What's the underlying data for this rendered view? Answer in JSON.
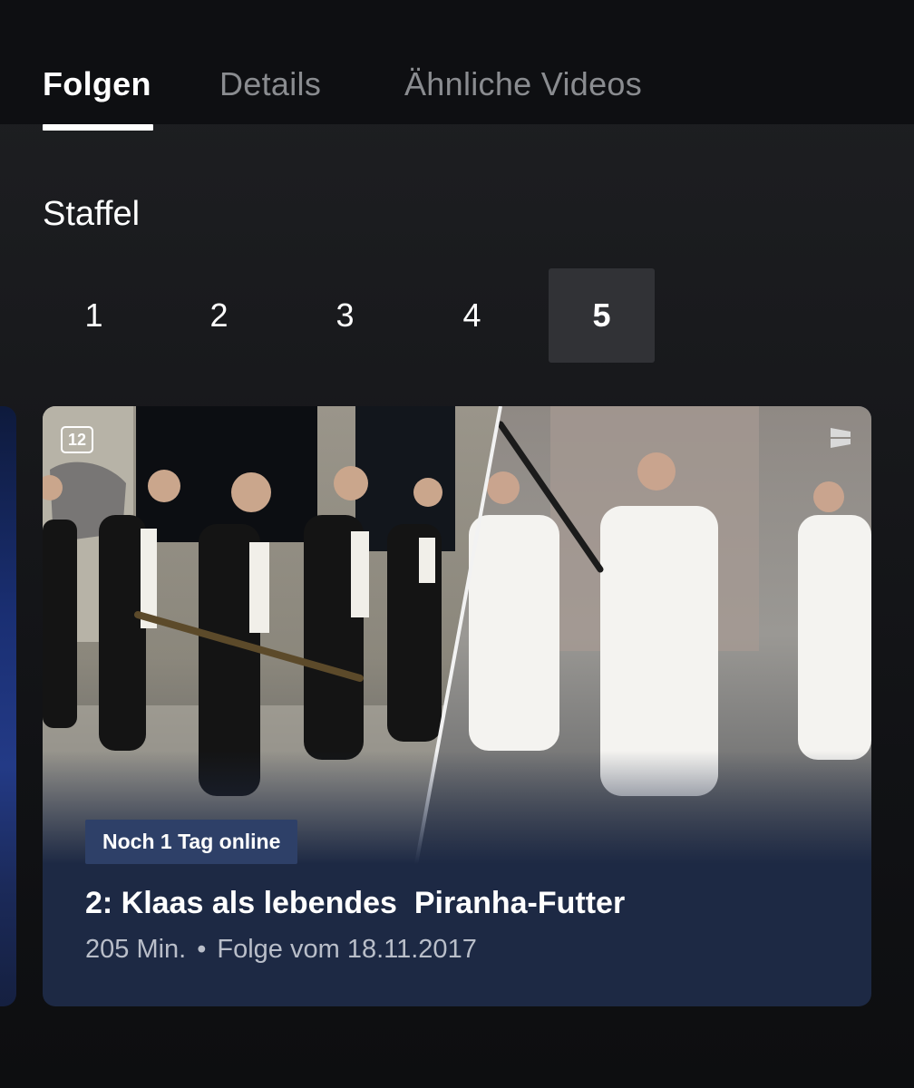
{
  "tabs": [
    {
      "label": "Folgen",
      "active": true
    },
    {
      "label": "Details",
      "active": false
    },
    {
      "label": "Ähnliche Videos",
      "active": false
    }
  ],
  "season_label": "Staffel",
  "seasons": [
    "1",
    "2",
    "3",
    "4",
    "5"
  ],
  "selected_season": "5",
  "episode": {
    "age_rating": "12",
    "availability": "Noch 1 Tag online",
    "title": "2: Klaas als lebendes  Piranha-Futter",
    "duration": "205 Min.",
    "separator": "•",
    "air_date": "Folge vom 18.11.2017",
    "channel_logo": "prosieben-logo-icon"
  },
  "colors": {
    "background": "#18191c",
    "tab_bar": "#0e0f12",
    "inactive_tab": "#8a8c90",
    "selected_season_bg": "#313236",
    "card_bg": "#1d2944",
    "badge_bg": "#2e4068",
    "meta_text": "#b9bec9"
  }
}
